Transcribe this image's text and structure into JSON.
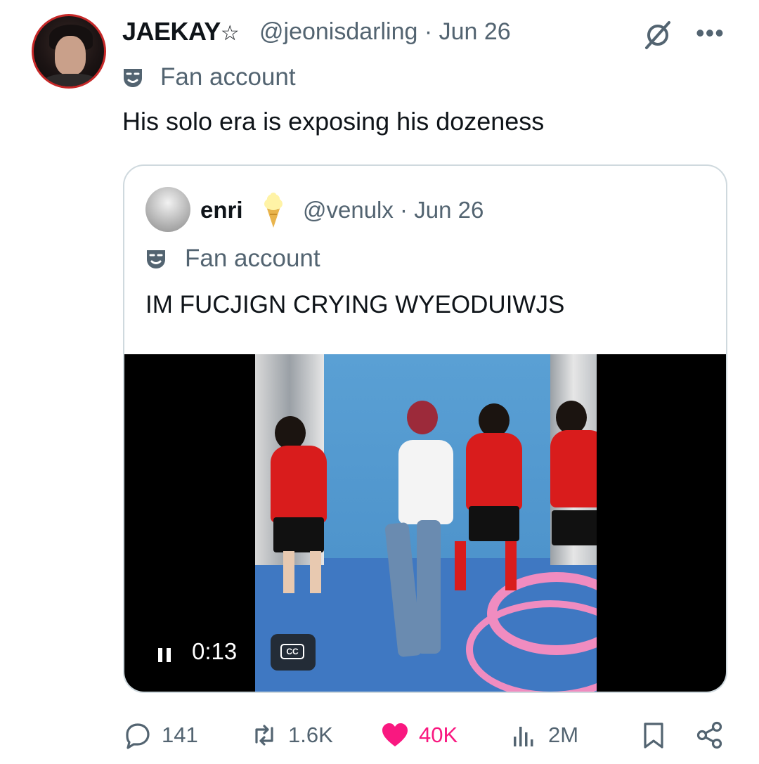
{
  "tweet": {
    "display_name": "JAEKAY",
    "name_symbol": "☆",
    "handle_date": "@jeonisdarling · Jun 26",
    "badge": "Fan account",
    "text": "His solo era is exposing his dozeness"
  },
  "quoted": {
    "display_name": "enri",
    "name_emoji": "ice-cream-icon",
    "handle_date": "@venulx · Jun 26",
    "badge": "Fan account",
    "text": "IM FUCJIGN CRYING WYEODUIWJS",
    "video": {
      "time": "0:13",
      "cc_label": "CC",
      "state": "playing"
    }
  },
  "actions": {
    "replies": "141",
    "reposts": "1.6K",
    "likes": "40K",
    "views": "2M"
  },
  "colors": {
    "text": "#0f1419",
    "secondary": "#536471",
    "like": "#f91880",
    "border": "#cfd9de"
  }
}
